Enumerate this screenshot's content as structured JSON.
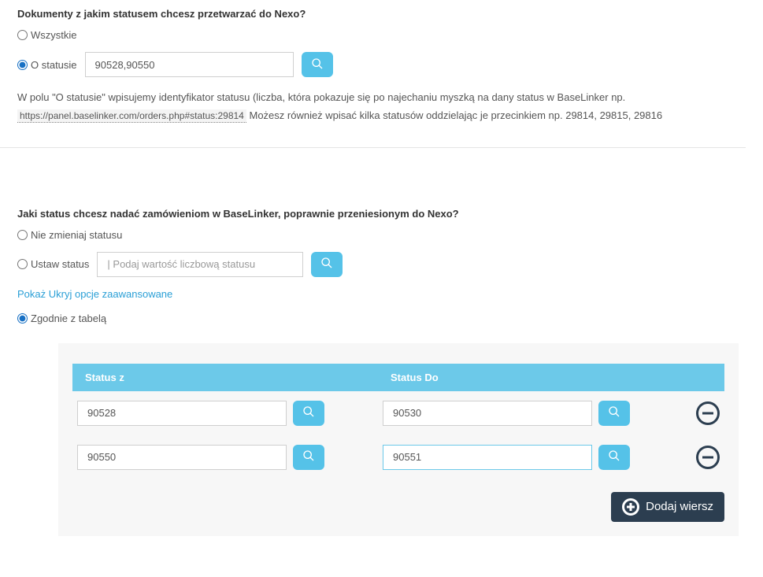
{
  "section1": {
    "title": "Dokumenty z jakim statusem chcesz przetwarzać do Nexo?",
    "opt_all": "Wszystkie",
    "opt_status": "O statusie",
    "status_value": "90528,90550",
    "hint_pre": "W polu \"O statusie\" wpisujemy identyfikator statusu (liczba, która pokazuje się po najechaniu myszką na dany status w BaseLinker np.",
    "hint_url": "https://panel.baselinker.com/orders.php#status:29814",
    "hint_post": "Możesz również wpisać kilka statusów oddzielając je przecinkiem np. 29814, 29815, 29816"
  },
  "section2": {
    "title": "Jaki status chcesz nadać zamówieniom w BaseLinker, poprawnie przeniesionym do Nexo?",
    "opt_none": "Nie zmieniaj statusu",
    "opt_set": "Ustaw status",
    "set_placeholder": "| Podaj wartość liczbową statusu",
    "advanced_link": "Pokaż Ukryj opcje zaawansowane",
    "opt_table": "Zgodnie z tabelą",
    "table_header_from": "Status z",
    "table_header_to": "Status Do",
    "rows": [
      {
        "from": "90528",
        "to": "90530"
      },
      {
        "from": "90550",
        "to": "90551"
      }
    ],
    "add_row_label": "Dodaj wiersz"
  }
}
